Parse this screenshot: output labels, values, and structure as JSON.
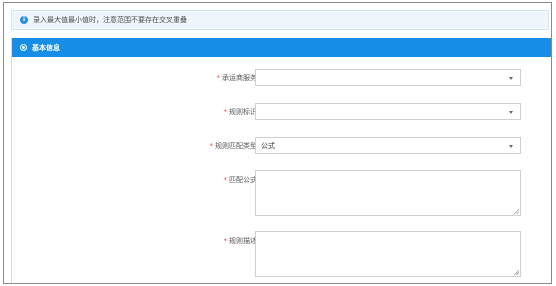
{
  "notice": {
    "icon": "info-icon",
    "text": "录入最大值最小值时，注意范围不要存在交叉重叠"
  },
  "section": {
    "icon": "settings-icon",
    "title": "基本信息"
  },
  "form": {
    "required_mark": "*",
    "carrier_service": {
      "label": "承运商服务",
      "value": ""
    },
    "rule_id": {
      "label": "规则标识",
      "value": ""
    },
    "rule_match_type": {
      "label": "规则匹配类型",
      "value": "公式"
    },
    "match_formula": {
      "label": "匹配公式",
      "value": ""
    },
    "rule_description": {
      "label": "规则描述",
      "value": ""
    }
  },
  "colors": {
    "header_blue": "#168ee6",
    "notice_bg": "#eef5fb",
    "required_red": "#e84a4a"
  }
}
